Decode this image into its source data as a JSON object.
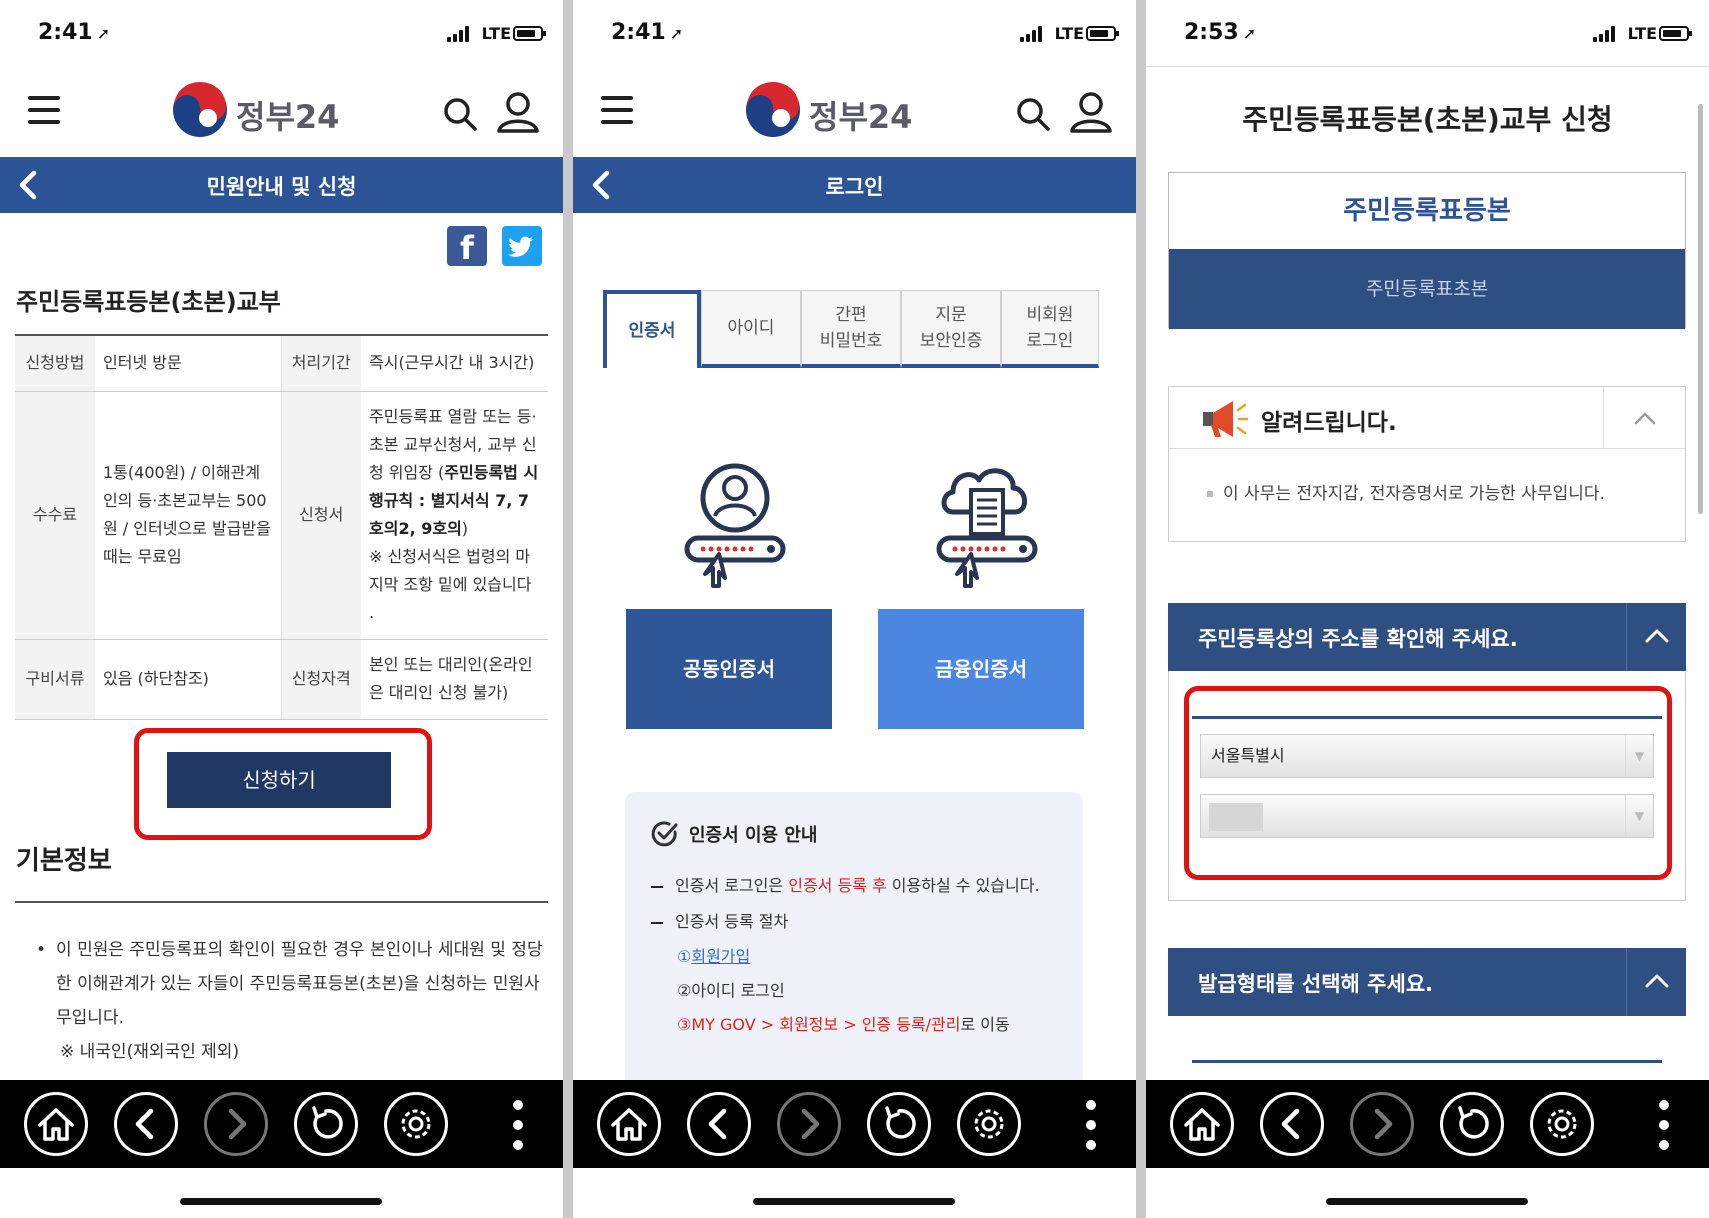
{
  "status_bars": [
    {
      "time": "2:41",
      "network": "LTE"
    },
    {
      "time": "2:41",
      "network": "LTE"
    },
    {
      "time": "2:53",
      "network": "LTE"
    }
  ],
  "header": {
    "logo_text": "정부24"
  },
  "panel1": {
    "title_bar": "민원안내 및 신청",
    "heading": "주민등록표등본(초본)교부",
    "table": {
      "row1": {
        "l1": "신청방법",
        "v1": "인터넷 방문",
        "l2": "처리기간",
        "v2": "즉시(근무시간 내 3시간)"
      },
      "row2": {
        "l1": "수수료",
        "v1": "1통(400원) / 이해관계인의 등·초본교부는 500원 / 인터넷으로 발급받을 때는 무료임",
        "l2": "신청서",
        "v2_a": "주민등록표 열람 또는 등·초본 교부신청서, 교부 신청 위임장 (",
        "v2_b": "주민등록법 시행규칙 : 별지서식 7, 7호의2, 9호의",
        "v2_c": ")",
        "v2_d": "※ 신청서식은 법령의 마지막 조항 밑에 있습니다",
        "v2_e": "."
      },
      "row3": {
        "l1": "구비서류",
        "v1": "있음 (하단참조)",
        "l2": "신청자격",
        "v2": "본인 또는 대리인(온라인은 대리인 신청 불가)"
      }
    },
    "apply_button": "신청하기",
    "basic_info_title": "기본정보",
    "basic_info_text": "이 민원은 주민등록표의 확인이 필요한 경우 본인이나 세대원 및 정당한 이해관계가 있는 자들이 주민등록표등본(초본)을 신청하는 민원사무입니다.",
    "basic_info_note": "※ 내국인(재외국인 제외)"
  },
  "panel2": {
    "title_bar": "로그인",
    "tabs": [
      {
        "label": "인증서"
      },
      {
        "label": "아이디"
      },
      {
        "label": "간편\n비밀번호"
      },
      {
        "label": "지문\n보안인증"
      },
      {
        "label": "비회원\n로그인"
      }
    ],
    "cert_buttons": [
      "공동인증서",
      "금융인증서"
    ],
    "guide": {
      "title": "인증서 이용 안내",
      "line1_a": "인증서 로그인은 ",
      "line1_b": "인증서 등록 후",
      "line1_c": " 이용하실 수 있습니다.",
      "line2": "인증서 등록 절차",
      "step1_num": "①",
      "step1": "회원가입",
      "step2": "②아이디 로그인",
      "step3_a": "③MY GOV > 회원정보 > 인증 등록/관리",
      "step3_b": "로 이동"
    }
  },
  "panel3": {
    "title": "주민등록표등본(초본)교부 신청",
    "seg_selected": "주민등록표등본",
    "seg_other": "주민등록표초본",
    "notice_title": "알려드립니다.",
    "notice_text": "이 사무는 전자지갑, 전자증명서로 가능한 사무입니다.",
    "address_header": "주민등록상의 주소를 확인해 주세요.",
    "select_city": "서울특별시",
    "issue_header": "발급형태를 선택해 주세요."
  },
  "colors": {
    "primary": "#2c5395",
    "dark_button": "#1f3864",
    "cert_blue": "#4b86e0",
    "highlight": "#e01313",
    "nav_bg": "#000000"
  }
}
